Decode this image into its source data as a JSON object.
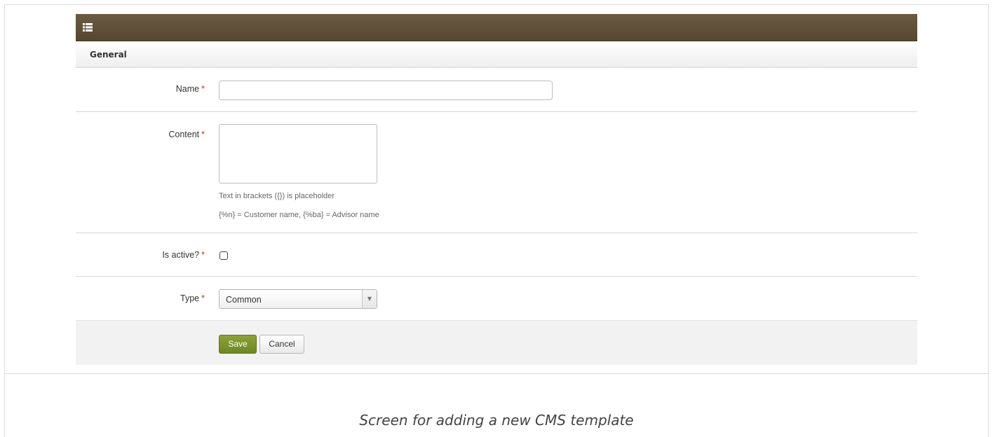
{
  "panel": {
    "header_icon": "list-icon",
    "section_title": "General"
  },
  "form": {
    "name": {
      "label": "Name",
      "required_mark": "*",
      "value": ""
    },
    "content": {
      "label": "Content",
      "required_mark": "*",
      "value": "",
      "help_lines": [
        "Text in brackets ({}) is placeholder",
        "{%n} = Customer name, {%ba} = Advisor name"
      ]
    },
    "is_active": {
      "label": "Is active?",
      "required_mark": "*",
      "checked": false
    },
    "type": {
      "label": "Type",
      "required_mark": "*",
      "selected": "Common",
      "arrow": "▼"
    }
  },
  "actions": {
    "save_label": "Save",
    "cancel_label": "Cancel"
  },
  "caption": "Screen for adding a new CMS template",
  "colors": {
    "header_bar": "#5f4e37",
    "save_button": "#7a922b",
    "required": "#d12a2a"
  }
}
